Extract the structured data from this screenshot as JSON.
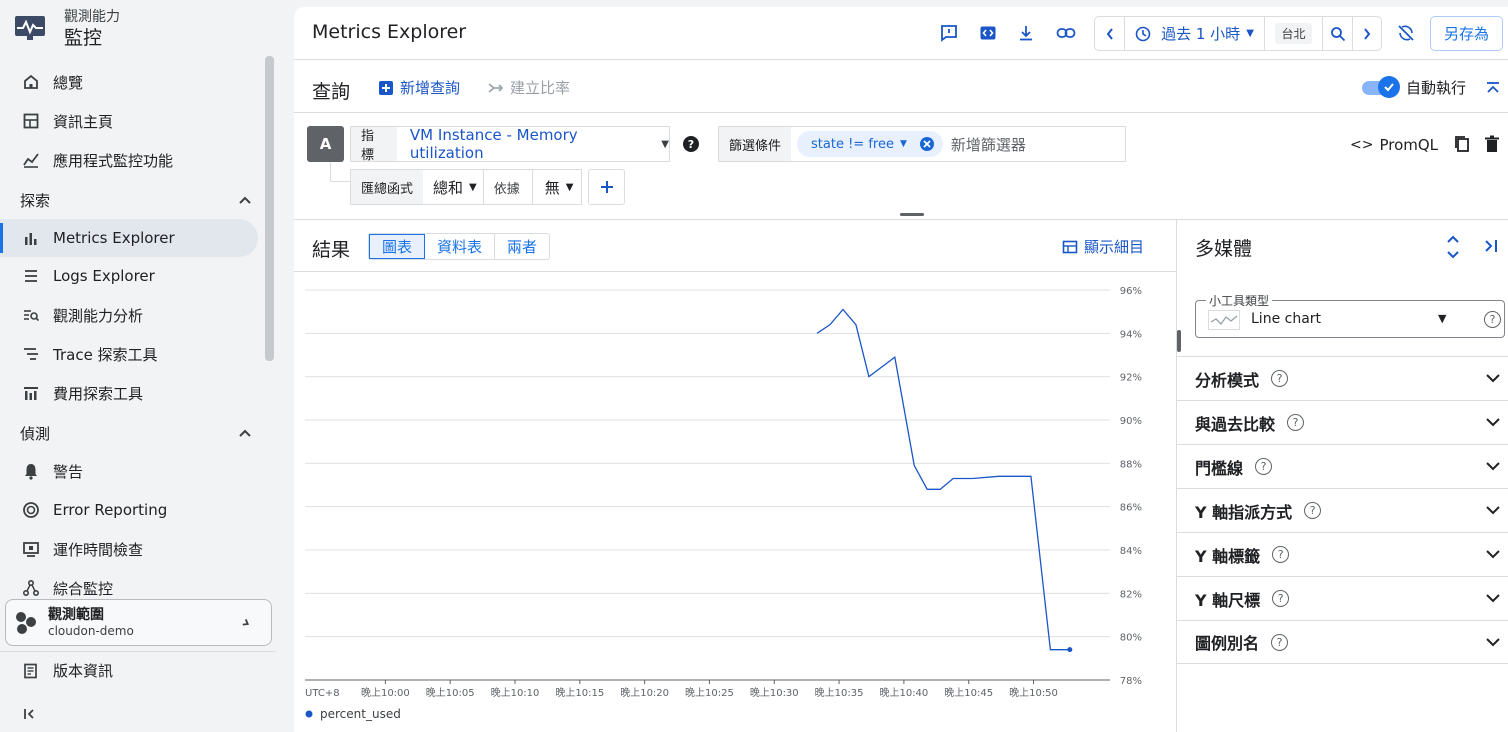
{
  "product": {
    "line1": "觀測能力",
    "line2": "監控"
  },
  "sidebar": {
    "top_items": [
      {
        "label": "總覽"
      },
      {
        "label": "資訊主頁"
      },
      {
        "label": "應用程式監控功能"
      }
    ],
    "explore_header": "探索",
    "explore_items": [
      {
        "label": "Metrics Explorer"
      },
      {
        "label": "Logs Explorer"
      },
      {
        "label": "觀測能力分析"
      },
      {
        "label": "Trace 探索工具"
      },
      {
        "label": "費用探索工具"
      }
    ],
    "detect_header": "偵測",
    "detect_items": [
      {
        "label": "警告"
      },
      {
        "label": "Error Reporting"
      },
      {
        "label": "運作時間檢查"
      },
      {
        "label": "綜合監控"
      }
    ],
    "scope": {
      "title": "觀測範圍",
      "project": "cloudon-demo"
    },
    "release_notes": "版本資訊"
  },
  "topbar": {
    "title": "Metrics Explorer",
    "time_range": "過去 1 小時",
    "timezone": "台北",
    "save_as": "另存為"
  },
  "query": {
    "title": "查詢",
    "add_query": "新增查詢",
    "build_ratio": "建立比率",
    "auto_run": "自動執行",
    "query_letter": "A",
    "metric_label": "指標",
    "metric_value": "VM Instance - Memory utilization",
    "filter_label": "篩選條件",
    "filter_chip": "state  !=  free",
    "filter_placeholder": "新增篩選器",
    "promql": "PromQL",
    "agg_label": "匯總函式",
    "agg_value": "總和",
    "by_label": "依據",
    "by_value": "無"
  },
  "results": {
    "title": "結果",
    "tabs": [
      "圖表",
      "資料表",
      "兩者"
    ],
    "show_details": "顯示細目"
  },
  "panel": {
    "title": "多媒體",
    "widget_type_label": "小工具類型",
    "widget_type_value": "Line chart",
    "sections": [
      {
        "label": "分析模式"
      },
      {
        "label": "與過去比較"
      },
      {
        "label": "門檻線"
      },
      {
        "label": "Y 軸指派方式"
      },
      {
        "label": "Y 軸標籤"
      },
      {
        "label": "Y 軸尺標"
      },
      {
        "label": "圖例別名"
      }
    ]
  },
  "chart_data": {
    "type": "line",
    "timezone_label": "UTC+8",
    "x_ticks": [
      "晚上10:00",
      "晚上10:05",
      "晚上10:10",
      "晚上10:15",
      "晚上10:20",
      "晚上10:25",
      "晚上10:30",
      "晚上10:35",
      "晚上10:40",
      "晚上10:45",
      "晚上10:50"
    ],
    "y_ticks": [
      "96%",
      "94%",
      "92%",
      "90%",
      "88%",
      "86%",
      "84%",
      "82%",
      "80%",
      "78%"
    ],
    "ylim": [
      78,
      96
    ],
    "xlim_minutes_after_2200": [
      -6.2,
      55.9
    ],
    "grid": true,
    "legend_position": "bottom-left",
    "series": [
      {
        "name": "percent_used",
        "color": "#1a56c8",
        "x_minutes_after_2200": [
          33.3,
          34.3,
          35.3,
          36.3,
          37.3,
          39.3,
          40.8,
          41.8,
          42.8,
          43.8,
          45.3,
          47.3,
          48.3,
          49.8,
          51.3,
          52.8
        ],
        "y": [
          94.0,
          94.4,
          95.1,
          94.4,
          92.0,
          92.9,
          87.9,
          86.8,
          86.8,
          87.3,
          87.3,
          87.4,
          87.4,
          87.4,
          79.4,
          79.4
        ]
      }
    ]
  }
}
